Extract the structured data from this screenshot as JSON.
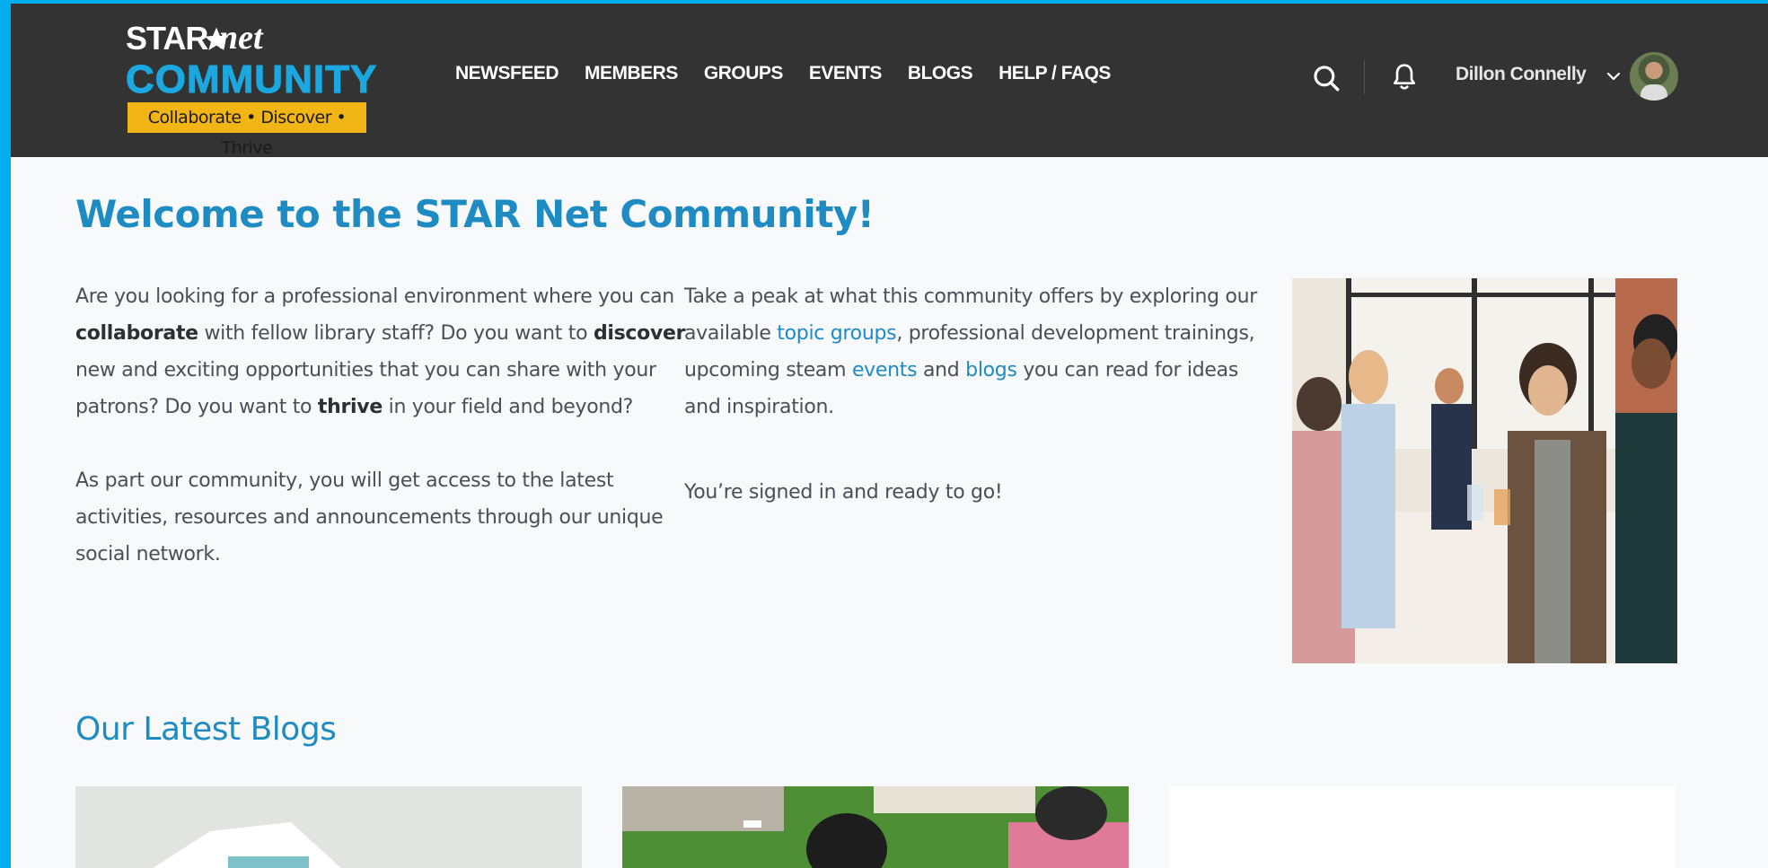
{
  "logo": {
    "star": "STAR",
    "net": "net",
    "community": "COMMUNITY",
    "tagline": "Collaborate • Discover • Thrive"
  },
  "nav": {
    "items": [
      "NEWSFEED",
      "MEMBERS",
      "GROUPS",
      "EVENTS",
      "BLOGS",
      "HELP / FAQS"
    ]
  },
  "header": {
    "user_name": "Dillon Connelly",
    "icons": [
      "search-icon",
      "bell-icon",
      "chevron-down-icon",
      "avatar"
    ]
  },
  "main": {
    "title": "Welcome to the STAR Net Community!",
    "col1": {
      "p1_a": "Are you looking for a professional environment where you can ",
      "p1_b1": "collaborate",
      "p1_c": " with fellow library staff? Do you want to ",
      "p1_b2": "discover",
      "p1_d": " new and exciting opportunities that you can share with your patrons? Do you want to ",
      "p1_b3": "thrive",
      "p1_e": " in your field and beyond?",
      "p2": "As part our community, you will get access to the latest activities, resources and announcements through our unique social network."
    },
    "col2": {
      "p1_a": "Take a peak at what this community offers by exploring our available ",
      "link_groups": "topic groups",
      "p1_b": ", professional development trainings, upcoming steam ",
      "link_events": "events",
      "p1_c": " and ",
      "link_blogs": "blogs",
      "p1_d": " you can read for ideas and inspiration.",
      "p2": "You’re signed in and ready to go!"
    }
  },
  "blogs": {
    "title": "Our Latest Blogs"
  },
  "colors": {
    "header_bg": "#333333",
    "accent": "#1e8bc3",
    "frame": "#00aeef",
    "tagline_bg": "#f2b516"
  }
}
